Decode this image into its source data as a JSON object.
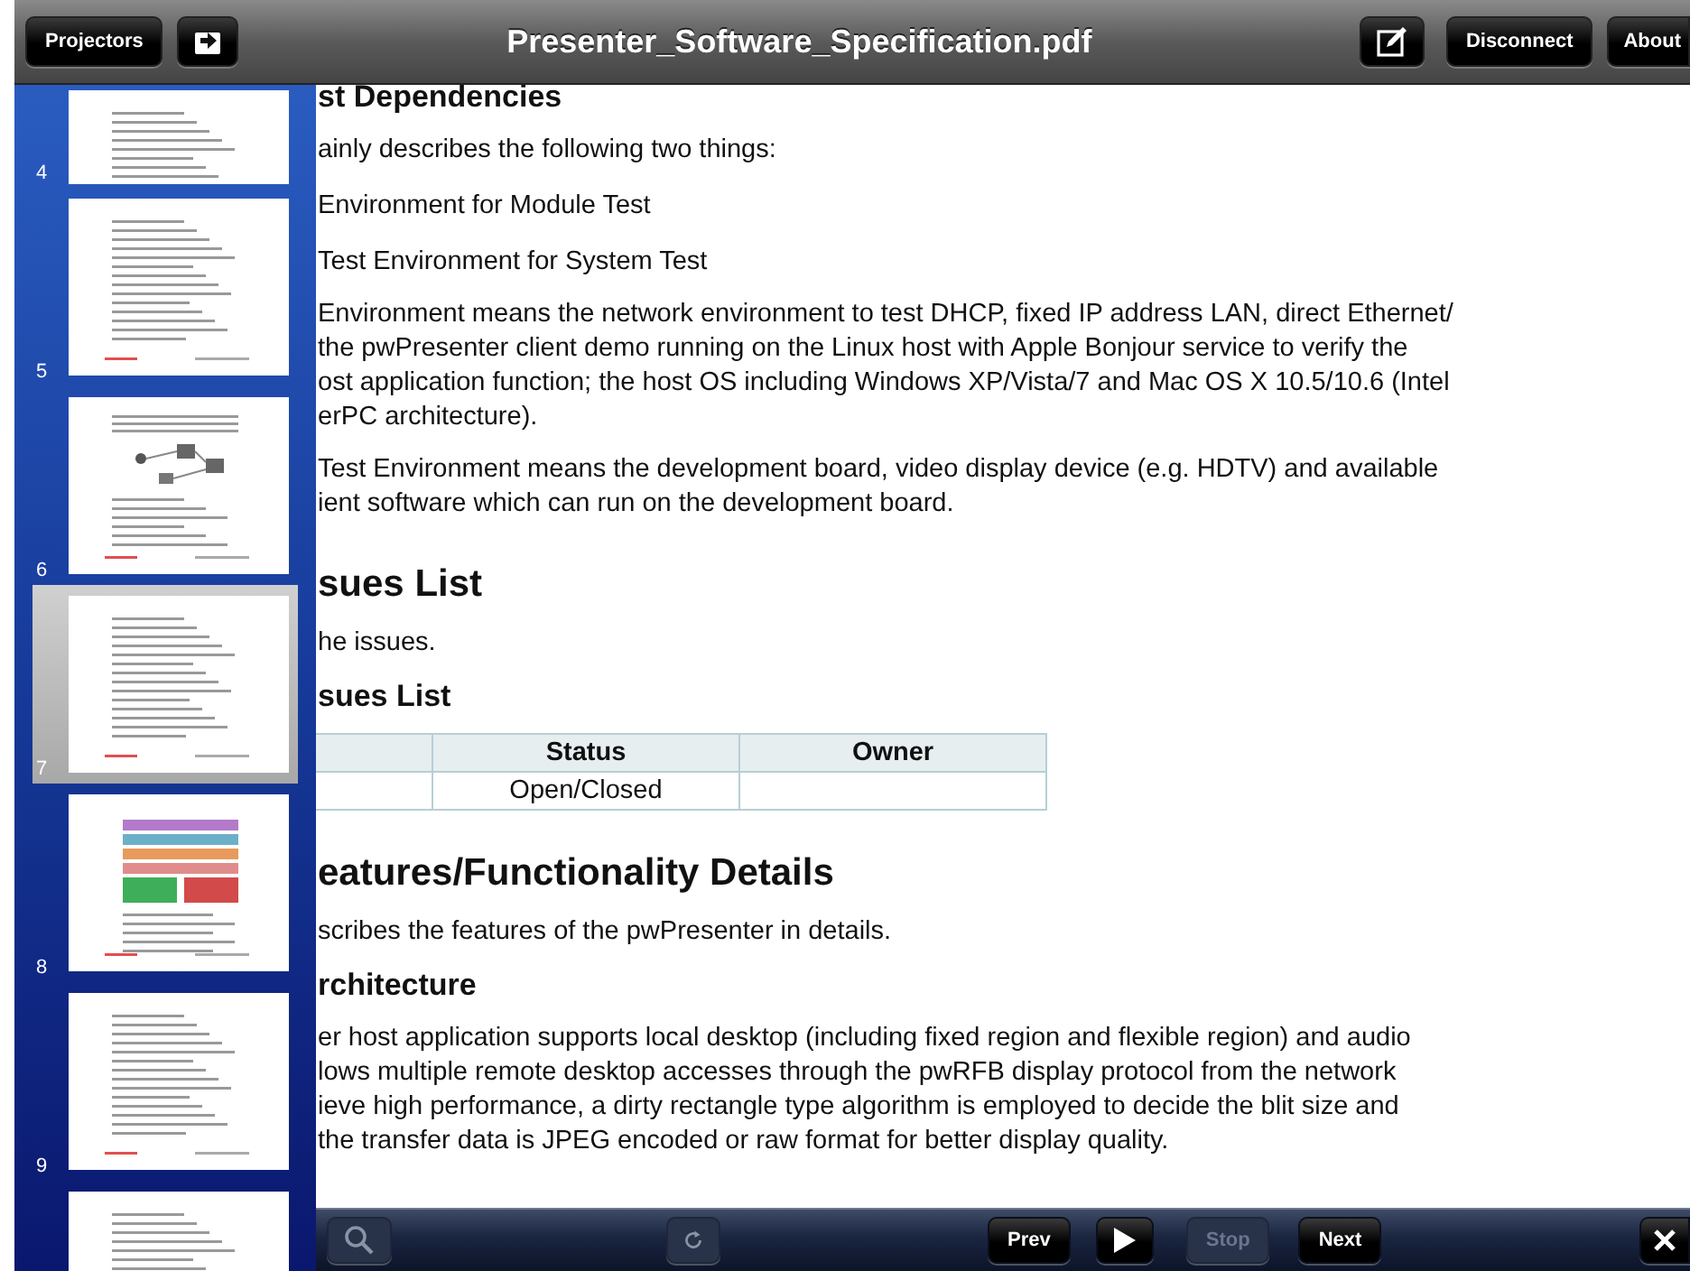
{
  "top_bar": {
    "title": "Presenter_Software_Specification.pdf",
    "left": [
      {
        "kind": "text",
        "label": "Projectors"
      },
      {
        "kind": "export"
      }
    ],
    "right": [
      {
        "kind": "edit"
      },
      {
        "kind": "text",
        "label": "Disconnect"
      },
      {
        "kind": "text",
        "label": "About"
      }
    ]
  },
  "sidebar": {
    "pages": [
      {
        "label": "4",
        "kind": "text",
        "selected": false
      },
      {
        "label": "5",
        "kind": "text",
        "selected": false
      },
      {
        "label": "6",
        "kind": "diagram",
        "selected": false
      },
      {
        "label": "7",
        "kind": "text",
        "selected": true
      },
      {
        "label": "8",
        "kind": "blocks",
        "selected": false
      },
      {
        "label": "9",
        "kind": "text",
        "selected": false
      },
      {
        "kind": "text",
        "selected": false
      }
    ]
  },
  "document": {
    "blocks": [
      {
        "kind": "heading3",
        "text": "st Dependencies"
      },
      {
        "kind": "para",
        "text": "ainly describes the following two things:"
      },
      {
        "kind": "item",
        "text": "Environment for Module Test"
      },
      {
        "kind": "item",
        "text": "Test Environment for System Test"
      },
      {
        "kind": "para",
        "text": "Environment means the network environment to test DHCP, fixed IP address LAN, direct Ethernet/\nthe pwPresenter client demo running on the Linux host with Apple Bonjour service to verify the\nost application function; the host OS including Windows XP/Vista/7 and Mac OS X 10.5/10.6 (Intel\nerPC architecture)."
      },
      {
        "kind": "para",
        "text": "Test Environment means the development board, video display device (e.g. HDTV) and available\nient software which can run on the development board."
      },
      {
        "kind": "heading2",
        "text": "sues List"
      },
      {
        "kind": "para",
        "text": "he issues."
      },
      {
        "kind": "heading3",
        "text": "sues List"
      },
      {
        "kind": "table",
        "columns": [
          "Status",
          "Owner"
        ],
        "rows": [
          [
            "Open/Closed"
          ]
        ]
      },
      {
        "kind": "heading2",
        "text": "eatures/Functionality Details"
      },
      {
        "kind": "para",
        "text": "scribes the features of the pwPresenter in details."
      },
      {
        "kind": "heading3",
        "text": "rchitecture"
      },
      {
        "kind": "para",
        "text": "er host application supports local desktop (including fixed region and flexible region) and audio\nlows multiple remote desktop accesses through the pwRFB display protocol from the network\nieve high performance, a dirty rectangle type algorithm is employed to decide the blit size and\nthe transfer data is JPEG encoded or raw format for better display quality."
      }
    ]
  },
  "toolbar": {
    "items": [
      {
        "kind": "search",
        "disabled": true
      },
      {
        "kind": "refresh",
        "disabled": true
      },
      {
        "kind": "text",
        "label": "Prev",
        "disabled": false
      },
      {
        "kind": "play",
        "disabled": false
      },
      {
        "kind": "text",
        "label": "Stop",
        "disabled": true
      },
      {
        "kind": "text",
        "label": "Next",
        "disabled": false
      },
      {
        "kind": "close",
        "disabled": false
      }
    ]
  }
}
